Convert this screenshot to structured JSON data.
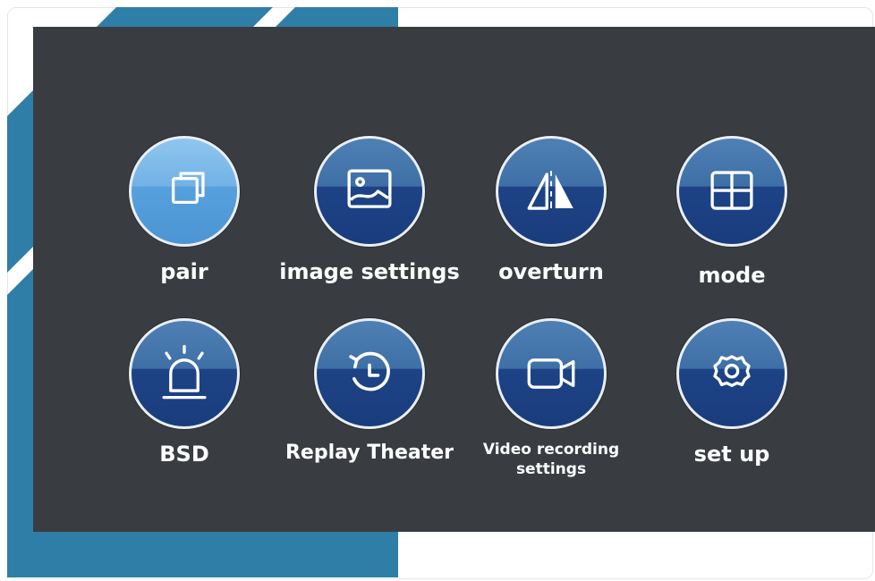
{
  "menu": {
    "items": [
      {
        "id": "pair",
        "label": "pair",
        "icon": "pair-icon",
        "active": true
      },
      {
        "id": "image-settings",
        "label": "image settings",
        "icon": "image-icon",
        "active": false
      },
      {
        "id": "overturn",
        "label": "overturn",
        "icon": "overturn-icon",
        "active": false
      },
      {
        "id": "mode",
        "label": "mode",
        "icon": "grid-mode-icon",
        "active": false
      },
      {
        "id": "bsd",
        "label": "BSD",
        "icon": "alarm-siren-icon",
        "active": false
      },
      {
        "id": "replay-theater",
        "label": "Replay Theater",
        "icon": "replay-history-icon",
        "active": false
      },
      {
        "id": "video-recording-settings",
        "label_line1": "Video recording",
        "label_line2": "settings",
        "icon": "video-camera-icon",
        "active": false
      },
      {
        "id": "set-up",
        "label": "set up",
        "icon": "gear-icon",
        "active": false
      }
    ]
  },
  "colors": {
    "panel": "#393d42",
    "accent_blue": "#2f7ea8",
    "circle_dark": "#1a3c7d",
    "circle_active": "#5aa3dd"
  }
}
